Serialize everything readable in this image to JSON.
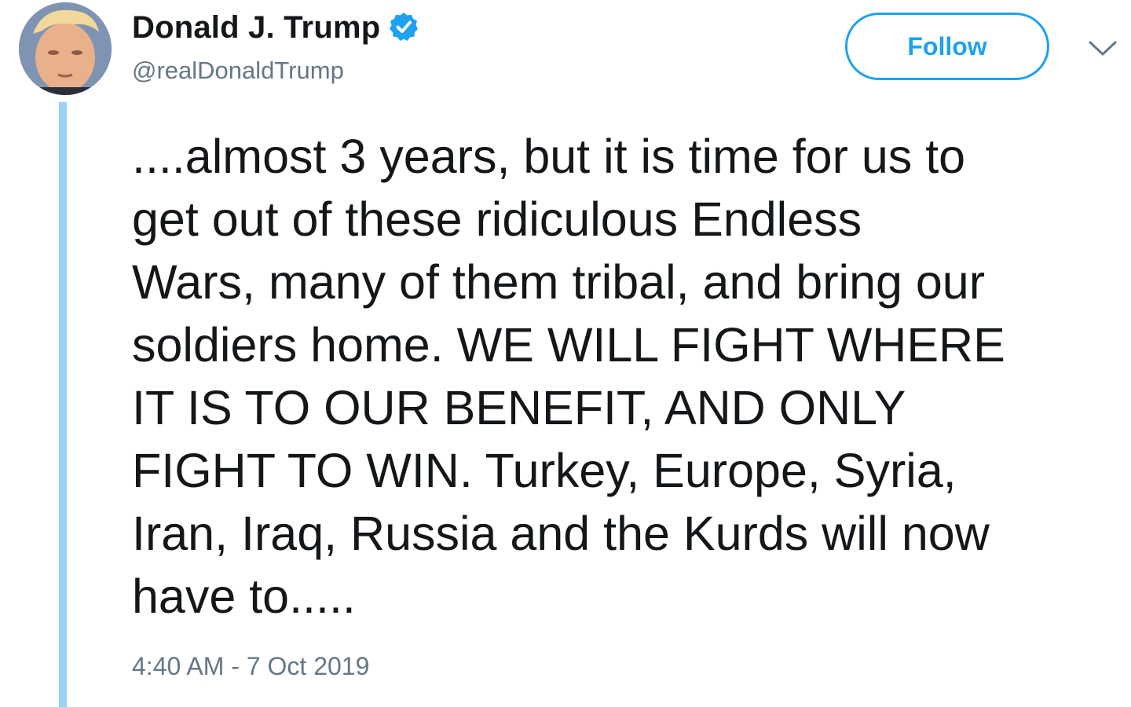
{
  "author": {
    "display_name": "Donald J. Trump",
    "handle": "@realDonaldTrump",
    "verified": true,
    "avatar_icon": "profile-photo"
  },
  "actions": {
    "follow_label": "Follow",
    "more_icon": "chevron-down-icon"
  },
  "tweet": {
    "lines": [
      "....almost 3 years, but it is time for us to",
      "get out of these ridiculous Endless",
      "Wars, many of them tribal, and bring our",
      "soldiers home. WE WILL FIGHT WHERE",
      "IT IS TO OUR BENEFIT, AND ONLY",
      "FIGHT TO WIN. Turkey, Europe, Syria,",
      "Iran, Iraq, Russia and the Kurds will now",
      "have to....."
    ],
    "timestamp": "4:40 AM - 7 Oct 2019"
  },
  "colors": {
    "accent": "#1da1f2",
    "thread_line": "#9ad3f4",
    "text_primary": "#14171a",
    "text_secondary": "#657786"
  }
}
